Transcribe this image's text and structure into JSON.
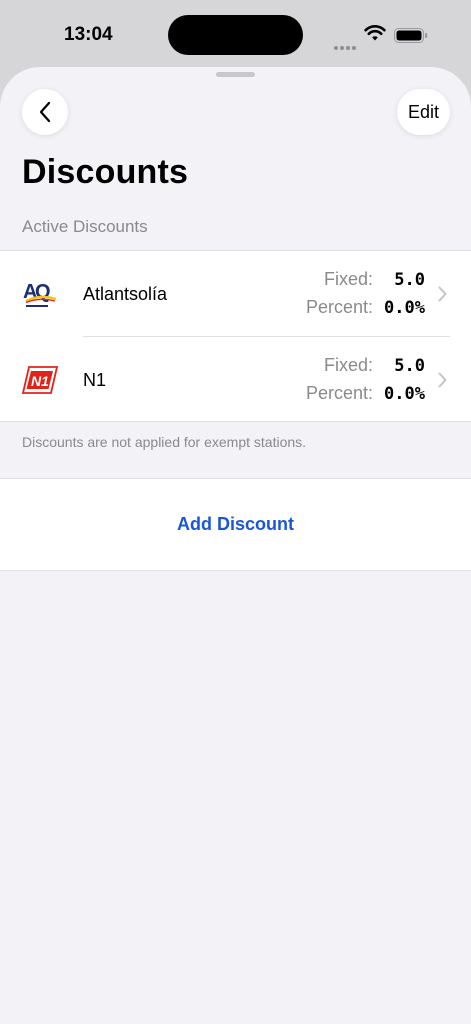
{
  "status_bar": {
    "time": "13:04"
  },
  "header": {
    "edit_label": "Edit",
    "title": "Discounts"
  },
  "section": {
    "title": "Active Discounts"
  },
  "discounts": [
    {
      "name": "Atlantsolía",
      "fixed_label": "Fixed:",
      "fixed_value": "5.0",
      "percent_label": "Percent:",
      "percent_value": "0.0%",
      "logo": "atlantsolia-logo"
    },
    {
      "name": "N1",
      "fixed_label": "Fixed:",
      "fixed_value": "5.0",
      "percent_label": "Percent:",
      "percent_value": "0.0%",
      "logo": "n1-logo"
    }
  ],
  "footer_note": "Discounts are not applied for exempt stations.",
  "add_button_label": "Add Discount",
  "colors": {
    "accent": "#1a56db",
    "n1_red": "#e2231a",
    "atlantsolia_navy": "#1b2f78",
    "atlantsolia_yellow": "#f3c318"
  }
}
